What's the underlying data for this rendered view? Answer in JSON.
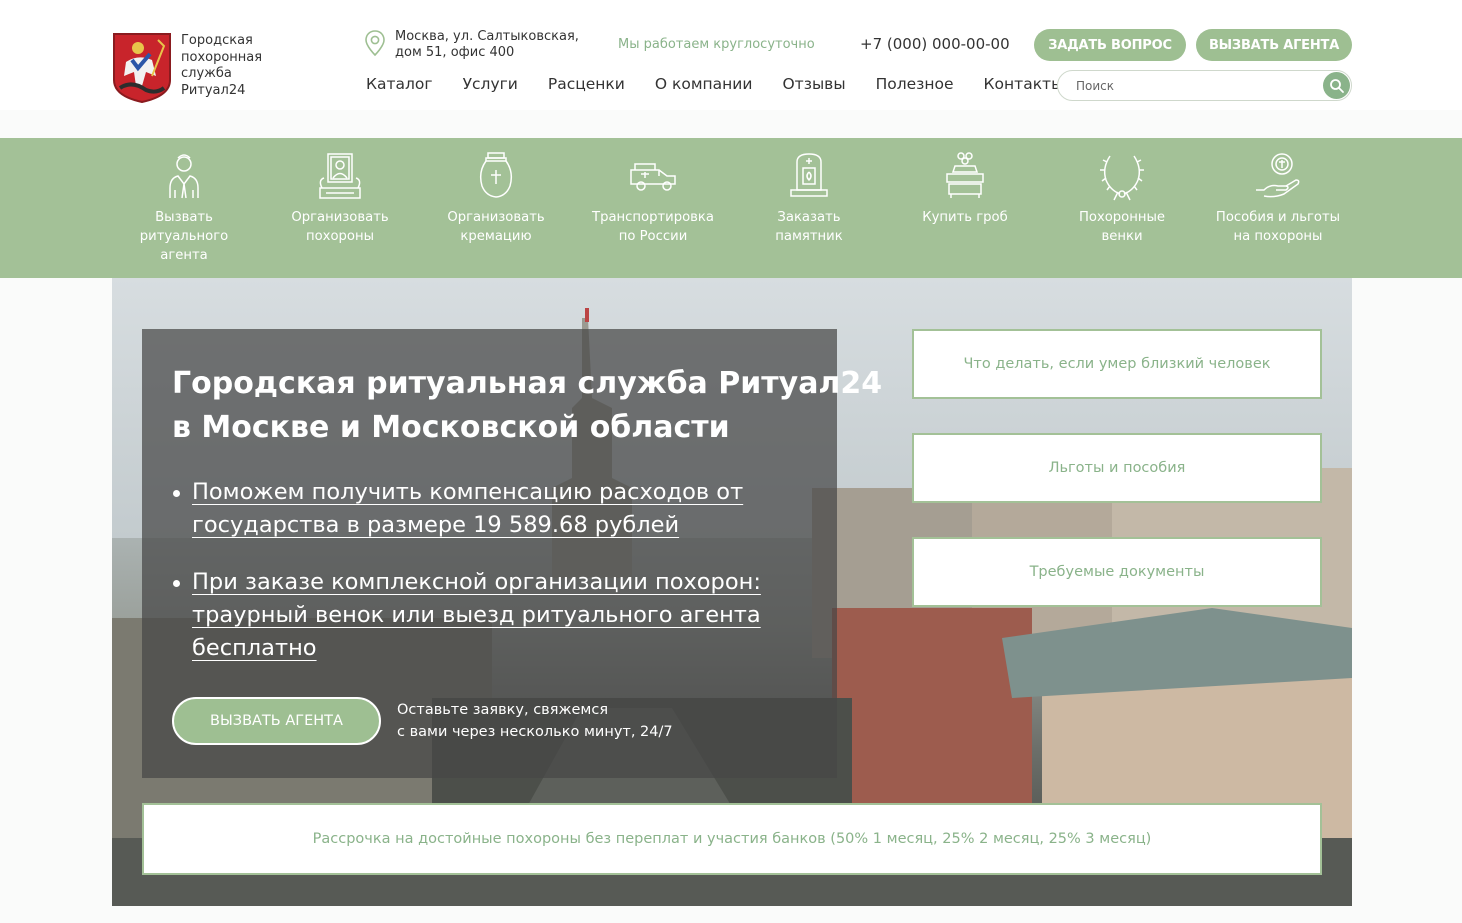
{
  "header": {
    "logo_lines": [
      "Городская",
      "похоронная",
      "служба",
      "Ритуал24"
    ],
    "address_lines": [
      "Москва, ул. Салтыковская,",
      "дом 51, офис 400"
    ],
    "worktime": "Мы работаем круглосуточно",
    "phone": "+7 (000) 000-00-00",
    "ask_button": "ЗАДАТЬ ВОПРОС",
    "agent_button": "ВЫЗВАТЬ АГЕНТА"
  },
  "nav": {
    "items": [
      {
        "label": "Каталог"
      },
      {
        "label": "Услуги"
      },
      {
        "label": "Расценки"
      },
      {
        "label": "О компании"
      },
      {
        "label": "Отзывы"
      },
      {
        "label": "Полезное"
      },
      {
        "label": "Контакты"
      }
    ]
  },
  "search": {
    "placeholder": "Поиск"
  },
  "services": [
    {
      "icon": "agent-icon",
      "lines": [
        "Вызвать",
        "ритуального",
        "агента"
      ]
    },
    {
      "icon": "portrait-icon",
      "lines": [
        "Организовать",
        "похороны"
      ]
    },
    {
      "icon": "urn-icon",
      "lines": [
        "Организовать",
        "кремацию"
      ]
    },
    {
      "icon": "hearse-icon",
      "lines": [
        "Транспортировка",
        "по России"
      ]
    },
    {
      "icon": "monument-icon",
      "lines": [
        "Заказать",
        "памятник"
      ]
    },
    {
      "icon": "coffin-icon",
      "lines": [
        "Купить гроб"
      ]
    },
    {
      "icon": "wreath-icon",
      "lines": [
        "Похоронные",
        "венки"
      ]
    },
    {
      "icon": "benefits-icon",
      "lines": [
        "Пособия и льготы",
        "на похороны"
      ]
    }
  ],
  "hero": {
    "title_lines": [
      "Городская ритуальная служба Ритуал24",
      "в Москве и Московской области"
    ],
    "bullets": [
      {
        "lines": [
          "Поможем получить компенсацию расходов от",
          "государства в размере 19 589.68 рублей"
        ]
      },
      {
        "lines": [
          "При заказе комплексной организации похорон:",
          "траурный венок или выезд ритуального агента",
          "бесплатно"
        ]
      }
    ],
    "cta_button": "ВЫЗВАТЬ АГЕНТА",
    "cta_note_lines": [
      "Оставьте заявку, свяжемся",
      "с вами через несколько минут, 24/7"
    ]
  },
  "side_cards": [
    {
      "label": "Что делать, если умер близкий человек"
    },
    {
      "label": "Льготы и пособия"
    },
    {
      "label": "Требуемые документы"
    }
  ],
  "installment": "Рассрочка на достойные похороны без переплат и участия банков (50% 1 месяц, 25% 2 месяц, 25% 3 месяц)",
  "colors": {
    "accent_green": "#9ebf92",
    "band_green": "#a3c197",
    "text_green": "#8ab38a"
  }
}
